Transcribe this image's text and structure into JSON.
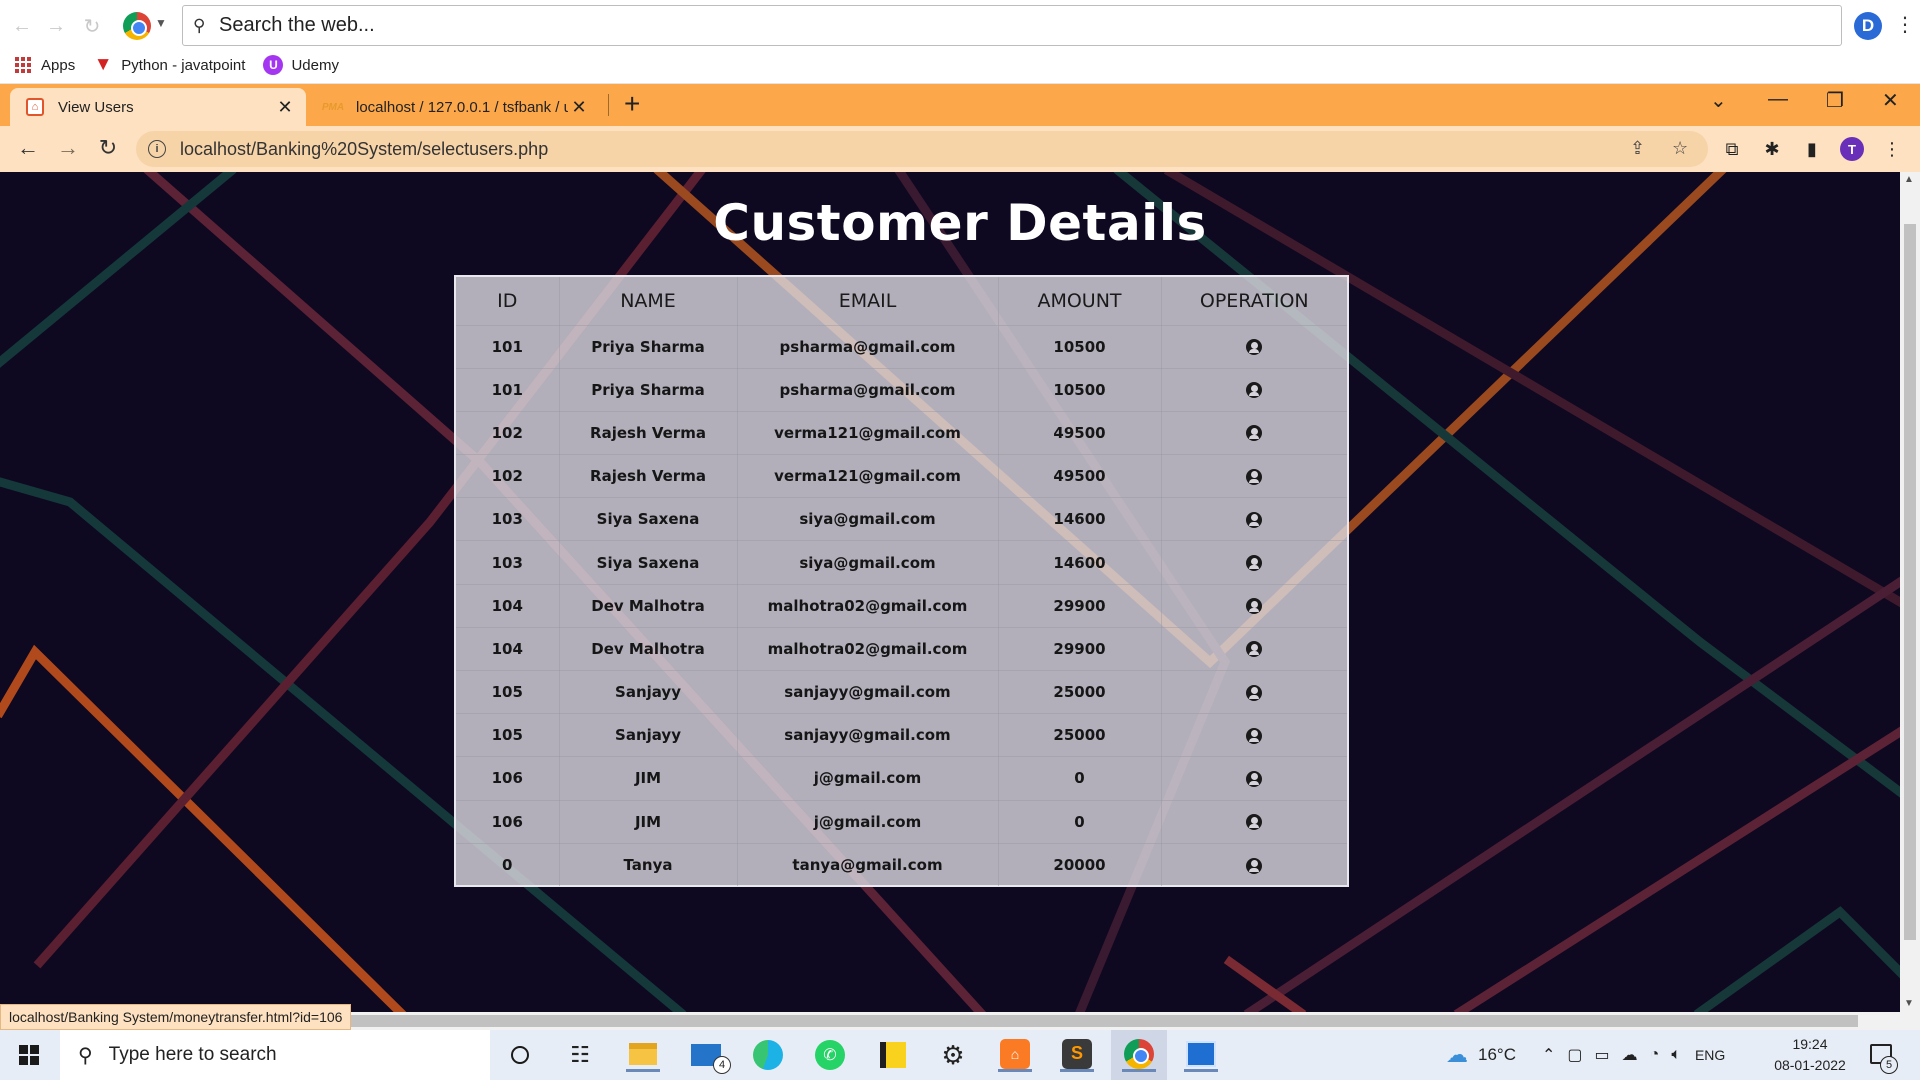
{
  "outer_browser": {
    "search_placeholder": "Search the web...",
    "profile_initial": "D",
    "bookmarks": [
      {
        "label": "Apps",
        "icon": "apps-grid-icon"
      },
      {
        "label": "Python - javatpoint",
        "icon": "javatpoint-icon"
      },
      {
        "label": "Udemy",
        "icon": "udemy-icon"
      }
    ]
  },
  "browser": {
    "tabs": [
      {
        "title": "View Users",
        "active": true
      },
      {
        "title": "localhost / 127.0.0.1 / tsfbank / u",
        "active": false
      }
    ],
    "address": "localhost/Banking%20System/selectusers.php",
    "profile_initial": "T",
    "status_url": "localhost/Banking System/moneytransfer.html?id=106",
    "theme_color": "#fca84a"
  },
  "page": {
    "title": "Customer Details",
    "background_color": "#0e0820"
  },
  "table": {
    "headers": [
      "ID",
      "NAME",
      "EMAIL",
      "AMOUNT",
      "OPERATION"
    ],
    "rows": [
      {
        "id": "101",
        "name": "Priya Sharma",
        "email": "psharma@gmail.com",
        "amount": "10500"
      },
      {
        "id": "101",
        "name": "Priya Sharma",
        "email": "psharma@gmail.com",
        "amount": "10500"
      },
      {
        "id": "102",
        "name": "Rajesh Verma",
        "email": "verma121@gmail.com",
        "amount": "49500"
      },
      {
        "id": "102",
        "name": "Rajesh Verma",
        "email": "verma121@gmail.com",
        "amount": "49500"
      },
      {
        "id": "103",
        "name": "Siya Saxena",
        "email": "siya@gmail.com",
        "amount": "14600"
      },
      {
        "id": "103",
        "name": "Siya Saxena",
        "email": "siya@gmail.com",
        "amount": "14600"
      },
      {
        "id": "104",
        "name": "Dev Malhotra",
        "email": "malhotra02@gmail.com",
        "amount": "29900"
      },
      {
        "id": "104",
        "name": "Dev Malhotra",
        "email": "malhotra02@gmail.com",
        "amount": "29900"
      },
      {
        "id": "105",
        "name": "Sanjayy",
        "email": "sanjayy@gmail.com",
        "amount": "25000"
      },
      {
        "id": "105",
        "name": "Sanjayy",
        "email": "sanjayy@gmail.com",
        "amount": "25000"
      },
      {
        "id": "106",
        "name": "JIM",
        "email": "j@gmail.com",
        "amount": "0"
      },
      {
        "id": "106",
        "name": "JIM",
        "email": "j@gmail.com",
        "amount": "0"
      },
      {
        "id": "0",
        "name": "Tanya",
        "email": "tanya@gmail.com",
        "amount": "20000"
      }
    ],
    "operation_icon": "user-circle-icon"
  },
  "taskbar": {
    "search_placeholder": "Type here to search",
    "mail_badge": "4",
    "apps": [
      "cortana-icon",
      "task-view-icon",
      "file-explorer-icon",
      "mail-icon",
      "edge-icon",
      "whatsapp-icon",
      "sticky-notes-icon",
      "settings-icon",
      "xampp-icon",
      "sublime-text-icon",
      "chrome-icon",
      "photos-icon"
    ],
    "weather": "16°C",
    "language": "ENG",
    "time": "19:24",
    "date": "08-01-2022",
    "notification_count": "5"
  }
}
